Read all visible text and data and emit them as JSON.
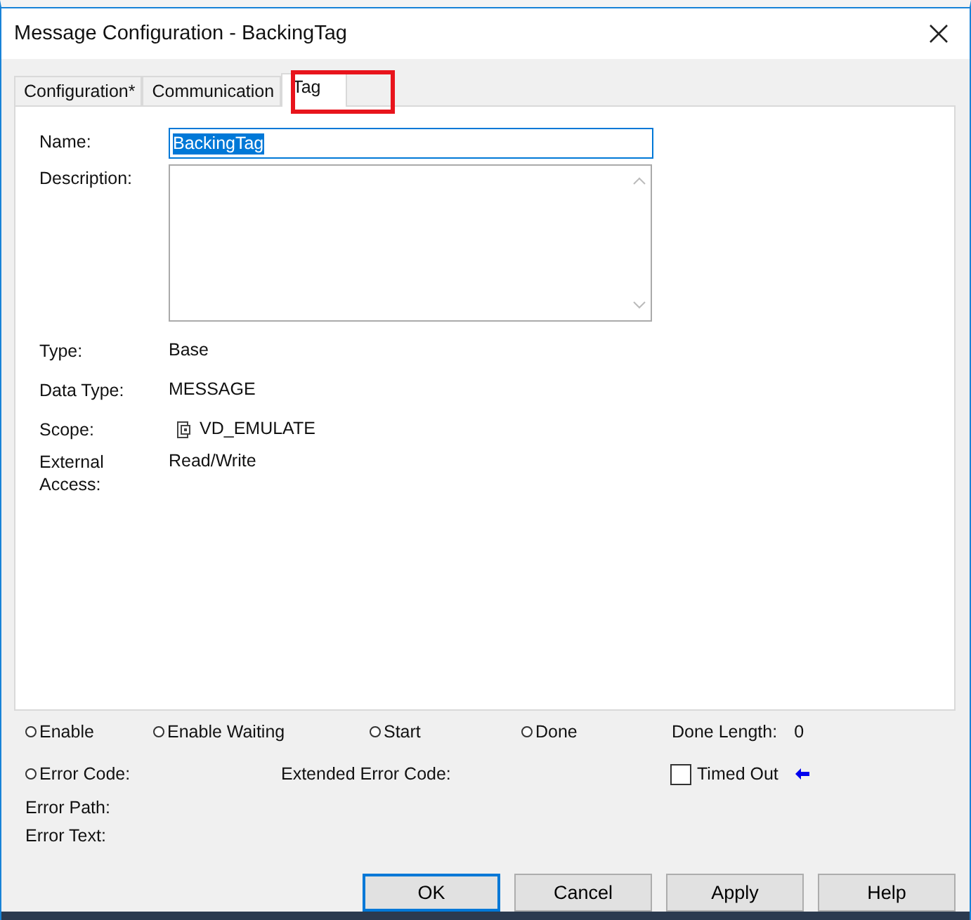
{
  "window": {
    "title": "Message Configuration - BackingTag"
  },
  "tabs": [
    {
      "label": "Configuration*",
      "selected": false
    },
    {
      "label": "Communication",
      "selected": false
    },
    {
      "label": "Tag",
      "selected": true
    }
  ],
  "name": {
    "label": "Name:",
    "value": "BackingTag"
  },
  "description": {
    "label": "Description:"
  },
  "properties": [
    {
      "label": "Type:",
      "value": "Base",
      "kind": "text"
    },
    {
      "label": "Data Type:",
      "value": "MESSAGE",
      "kind": "text"
    },
    {
      "label": "Scope:",
      "value": "VD_EMULATE",
      "kind": "scope"
    },
    {
      "label": "External Access:",
      "value": "Read/Write",
      "kind": "text"
    }
  ],
  "indicators": [
    {
      "label": "Enable",
      "on": false
    },
    {
      "label": "Enable Waiting",
      "on": false
    },
    {
      "label": "Start",
      "on": false
    },
    {
      "label": "Done",
      "on": false
    }
  ],
  "done_length": {
    "label": "Done Length:",
    "value": "0"
  },
  "error_code": {
    "label": "Error Code:",
    "on": false
  },
  "extended_error_code": {
    "label": "Extended Error Code:"
  },
  "timed_out": {
    "label": "Timed Out",
    "checked": false
  },
  "error_path": {
    "label": "Error Path:"
  },
  "error_text": {
    "label": "Error Text:"
  },
  "buttons": [
    {
      "label": "OK",
      "default": true
    },
    {
      "label": "Cancel",
      "default": false
    },
    {
      "label": "Apply",
      "default": false
    },
    {
      "label": "Help",
      "default": false
    }
  ]
}
